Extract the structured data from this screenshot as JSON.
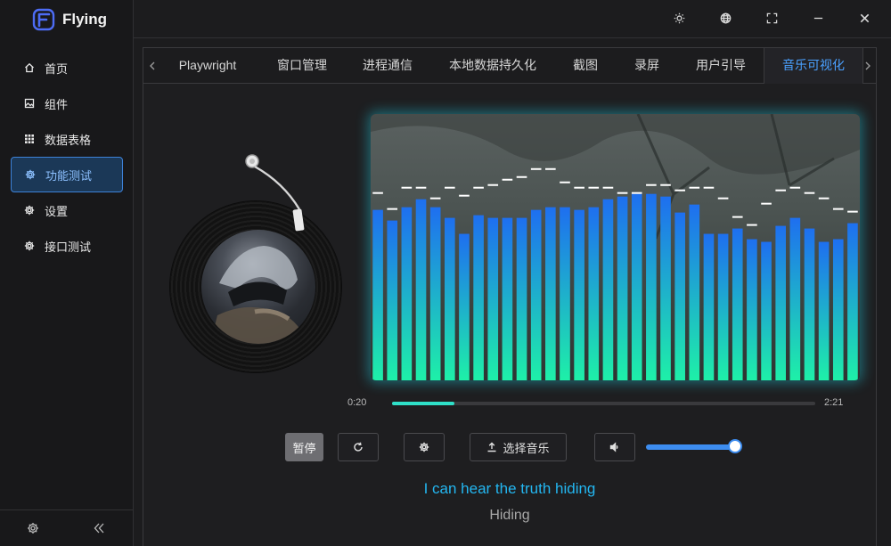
{
  "app": {
    "name": "Flying"
  },
  "sidebar": {
    "items": [
      {
        "label": "首页",
        "icon": "home-icon"
      },
      {
        "label": "组件",
        "icon": "image-icon"
      },
      {
        "label": "数据表格",
        "icon": "grid-icon"
      },
      {
        "label": "功能测试",
        "icon": "gear-icon",
        "active": true
      },
      {
        "label": "设置",
        "icon": "gear-icon"
      },
      {
        "label": "接口测试",
        "icon": "gear-icon"
      }
    ],
    "footer": {
      "settings_icon": "gear-icon",
      "collapse_icon": "double-chevron-left-icon"
    }
  },
  "titlebar": {
    "buttons": [
      "theme-sun-icon",
      "language-globe-icon",
      "fullscreen-icon",
      "minimize-icon",
      "close-icon"
    ]
  },
  "tabs": [
    {
      "label": "Playwright"
    },
    {
      "label": "窗口管理"
    },
    {
      "label": "进程通信"
    },
    {
      "label": "本地数据持久化"
    },
    {
      "label": "截图"
    },
    {
      "label": "录屏"
    },
    {
      "label": "用户引导"
    },
    {
      "label": "音乐可视化",
      "active": true
    }
  ],
  "player": {
    "current_time": "0:20",
    "duration": "2:21",
    "progress": 0.148,
    "buttons": {
      "pause_label": "暂停",
      "select_music_label": "选择音乐"
    },
    "volume": 1.0,
    "lyrics": {
      "current": "I can hear the truth hiding",
      "next": "Hiding"
    }
  },
  "visualizer": {
    "bars": [
      0.64,
      0.6,
      0.65,
      0.68,
      0.65,
      0.61,
      0.55,
      0.62,
      0.61,
      0.61,
      0.61,
      0.64,
      0.65,
      0.65,
      0.64,
      0.65,
      0.68,
      0.69,
      0.7,
      0.7,
      0.69,
      0.63,
      0.66,
      0.55,
      0.55,
      0.57,
      0.53,
      0.52,
      0.58,
      0.61,
      0.57,
      0.52,
      0.53,
      0.59
    ],
    "peaks": [
      0.7,
      0.64,
      0.72,
      0.72,
      0.68,
      0.72,
      0.69,
      0.72,
      0.73,
      0.75,
      0.76,
      0.79,
      0.79,
      0.74,
      0.72,
      0.72,
      0.72,
      0.7,
      0.7,
      0.73,
      0.73,
      0.71,
      0.72,
      0.72,
      0.68,
      0.61,
      0.58,
      0.66,
      0.71,
      0.72,
      0.7,
      0.68,
      0.64,
      0.63
    ],
    "bar_color_top": "#1e6ff0",
    "bar_color_bottom": "#1ef0a8"
  }
}
